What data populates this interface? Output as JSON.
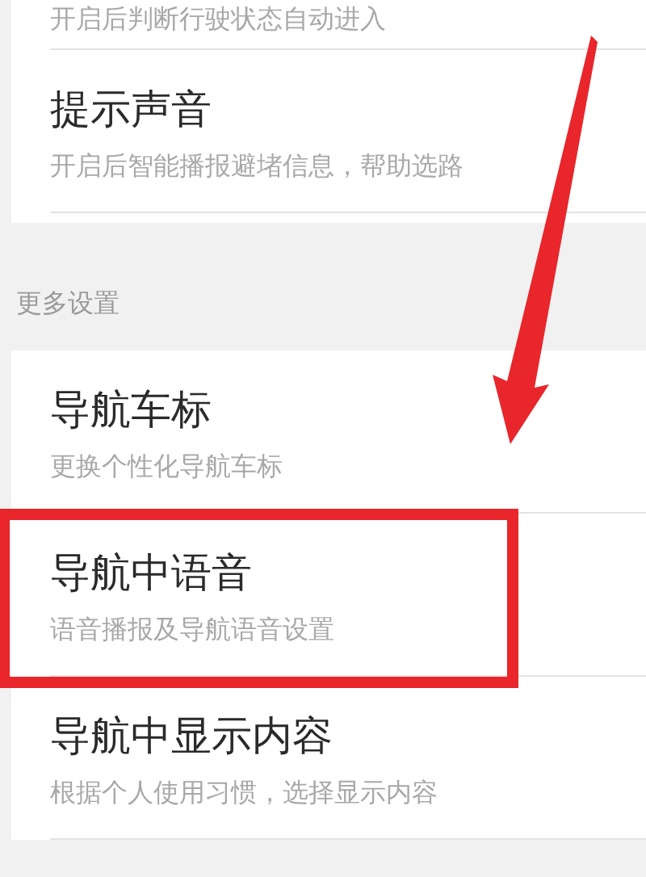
{
  "sections": [
    {
      "items": [
        {
          "subtitle": "开启后判断行驶状态自动进入",
          "highlighted": false
        },
        {
          "title": "提示声音",
          "subtitle": "开启后智能播报避堵信息，帮助选路",
          "highlighted": false
        }
      ]
    },
    {
      "header": "更多设置",
      "items": [
        {
          "title": "导航车标",
          "subtitle": "更换个性化导航车标",
          "highlighted": false
        },
        {
          "title": "导航中语音",
          "subtitle": "语音播报及导航语音设置",
          "highlighted": true
        },
        {
          "title": "导航中显示内容",
          "subtitle": "根据个人使用习惯，选择显示内容",
          "highlighted": false
        }
      ]
    }
  ]
}
